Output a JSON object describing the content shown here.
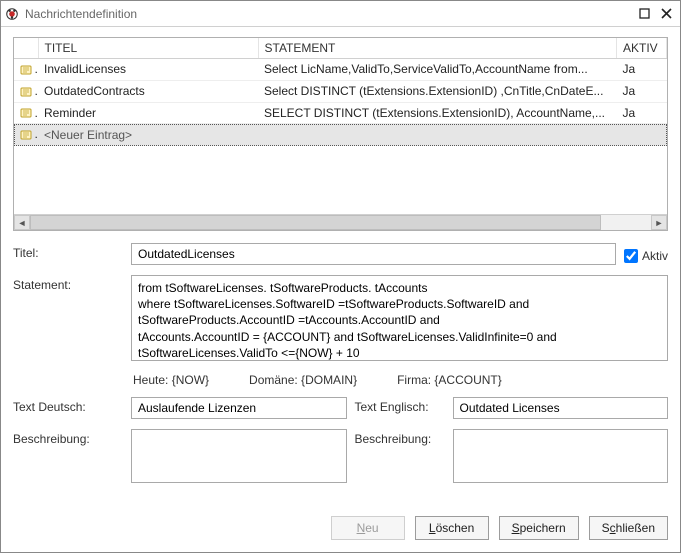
{
  "window": {
    "title": "Nachrichtendefinition"
  },
  "grid": {
    "headers": {
      "titel": "TITEL",
      "statement": "STATEMENT",
      "aktiv": "AKTIV"
    },
    "rows": [
      {
        "titel": "InvalidLicenses",
        "statement": "Select LicName,ValidTo,ServiceValidTo,AccountName from...",
        "aktiv": "Ja"
      },
      {
        "titel": "OutdatedContracts",
        "statement": "Select DISTINCT (tExtensions.ExtensionID) ,CnTitle,CnDateE...",
        "aktiv": "Ja"
      },
      {
        "titel": "Reminder",
        "statement": "SELECT DISTINCT (tExtensions.ExtensionID), AccountName,...",
        "aktiv": "Ja"
      }
    ],
    "new_entry": "<Neuer Eintrag>"
  },
  "labels": {
    "titel": "Titel:",
    "aktiv": "Aktiv",
    "statement": "Statement:",
    "heute": "Heute: {NOW}",
    "domaene": "Domäne: {DOMAIN}",
    "firma": "Firma: {ACCOUNT}",
    "text_de": "Text Deutsch:",
    "text_en": "Text Englisch:",
    "beschreibung": "Beschreibung:"
  },
  "form": {
    "titel": "OutdatedLicenses",
    "aktiv_checked": true,
    "statement": "from tSoftwareLicenses. tSoftwareProducts. tAccounts\nwhere tSoftwareLicenses.SoftwareID =tSoftwareProducts.SoftwareID and\ntSoftwareProducts.AccountID =tAccounts.AccountID and\ntAccounts.AccountID = {ACCOUNT} and tSoftwareLicenses.ValidInfinite=0 and\ntSoftwareLicenses.ValidTo <={NOW} + 10",
    "text_de": "Auslaufende Lizenzen",
    "text_en": "Outdated Licenses",
    "desc_de": "",
    "desc_en": ""
  },
  "buttons": {
    "neu": "Neu",
    "loeschen": "Löschen",
    "speichern": "Speichern",
    "schliessen": "Schließen"
  }
}
